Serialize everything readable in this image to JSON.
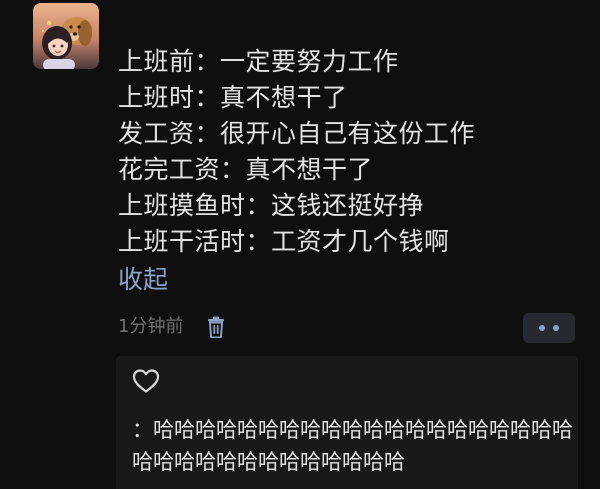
{
  "post": {
    "lines": [
      "上班前：一定要努力工作",
      "上班时：真不想干了",
      "发工资：很开心自己有这份工作",
      "花完工资：真不想干了",
      "上班摸鱼时：这钱还挺好挣",
      "上班干活时：工资才几个钱啊"
    ],
    "collapse_label": "收起",
    "timestamp": "1分钟前",
    "delete_icon": "trash-icon",
    "more_icon": "more-dots-icon"
  },
  "comments": {
    "like_icon": "heart-outline-icon",
    "items": [
      {
        "author": "",
        "separator": "：",
        "text": "哈哈哈哈哈哈哈哈哈哈哈哈哈哈哈哈哈哈哈哈哈哈哈哈哈哈哈哈哈哈哈哈哈"
      }
    ]
  },
  "colors": {
    "background": "#0f0f0f",
    "text": "#e3e3e3",
    "link": "#8aa1c8",
    "muted": "#6f6f6f",
    "panel": "#191919"
  }
}
